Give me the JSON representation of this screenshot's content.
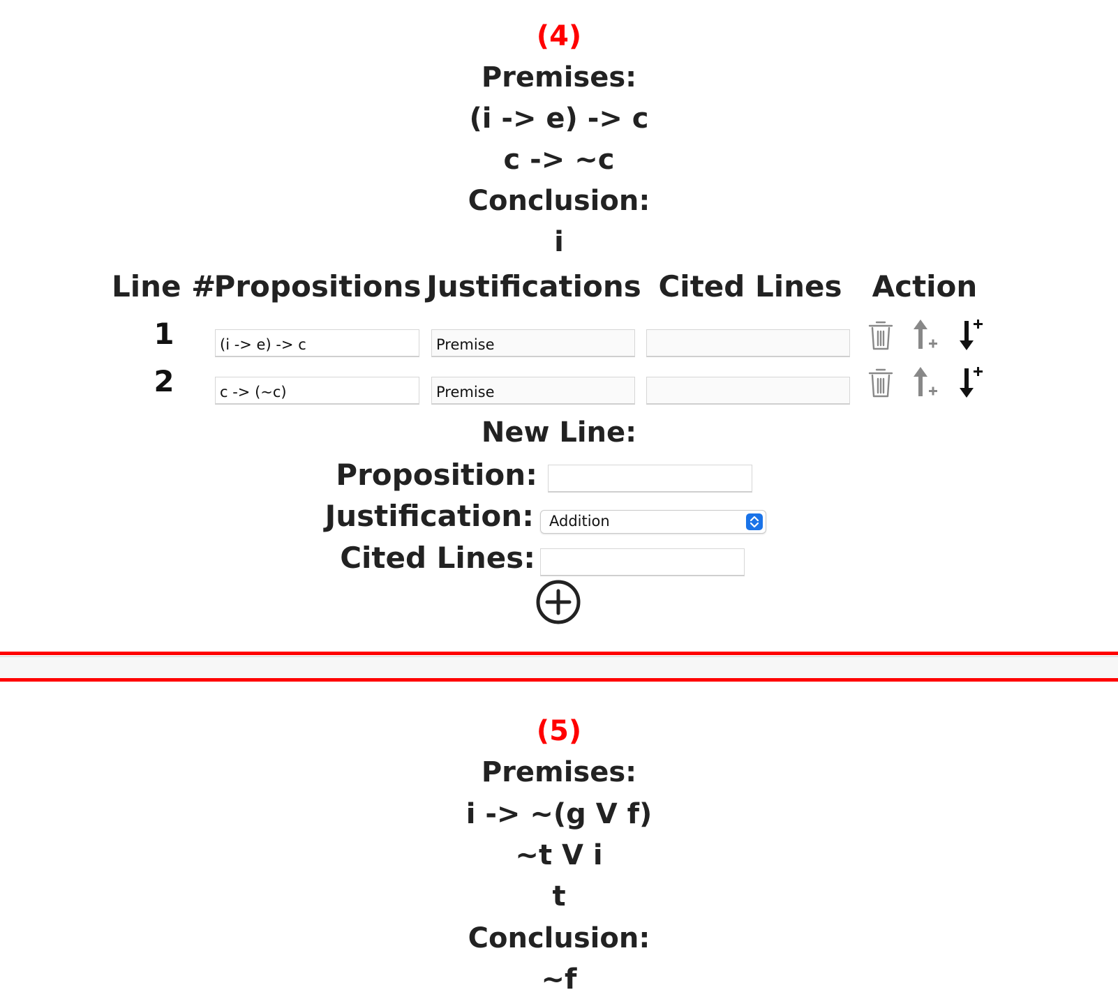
{
  "colors": {
    "accent_red": "#ff0000",
    "text": "#222222",
    "select_blue": "#1a73e8"
  },
  "problem4": {
    "number": "(4)",
    "premises_label": "Premises:",
    "premises": [
      "(i -> e) -> c",
      "c -> ~c"
    ],
    "conclusion_label": "Conclusion:",
    "conclusion": "i",
    "table": {
      "headers": [
        "Line #",
        "Propositions",
        "Justifications",
        "Cited Lines",
        "Action"
      ],
      "rows": [
        {
          "line": "1",
          "proposition": "(i -> e) -> c",
          "justification": "Premise",
          "cited": ""
        },
        {
          "line": "2",
          "proposition": "c -> (~c)",
          "justification": "Premise",
          "cited": ""
        }
      ],
      "action_icons": [
        "trash-icon",
        "insert-above-icon",
        "insert-below-icon"
      ]
    },
    "new_line": {
      "title": "New Line:",
      "proposition_label": "Proposition:",
      "proposition_value": "",
      "justification_label": "Justification:",
      "justification_selected": "Addition",
      "cited_label": "Cited Lines:",
      "cited_value": "",
      "add_icon": "plus-circle-icon"
    }
  },
  "problem5": {
    "number": "(5)",
    "premises_label": "Premises:",
    "premises": [
      "i -> ~(g V f)",
      "~t V i",
      "t"
    ],
    "conclusion_label": "Conclusion:",
    "conclusion": "~f"
  }
}
